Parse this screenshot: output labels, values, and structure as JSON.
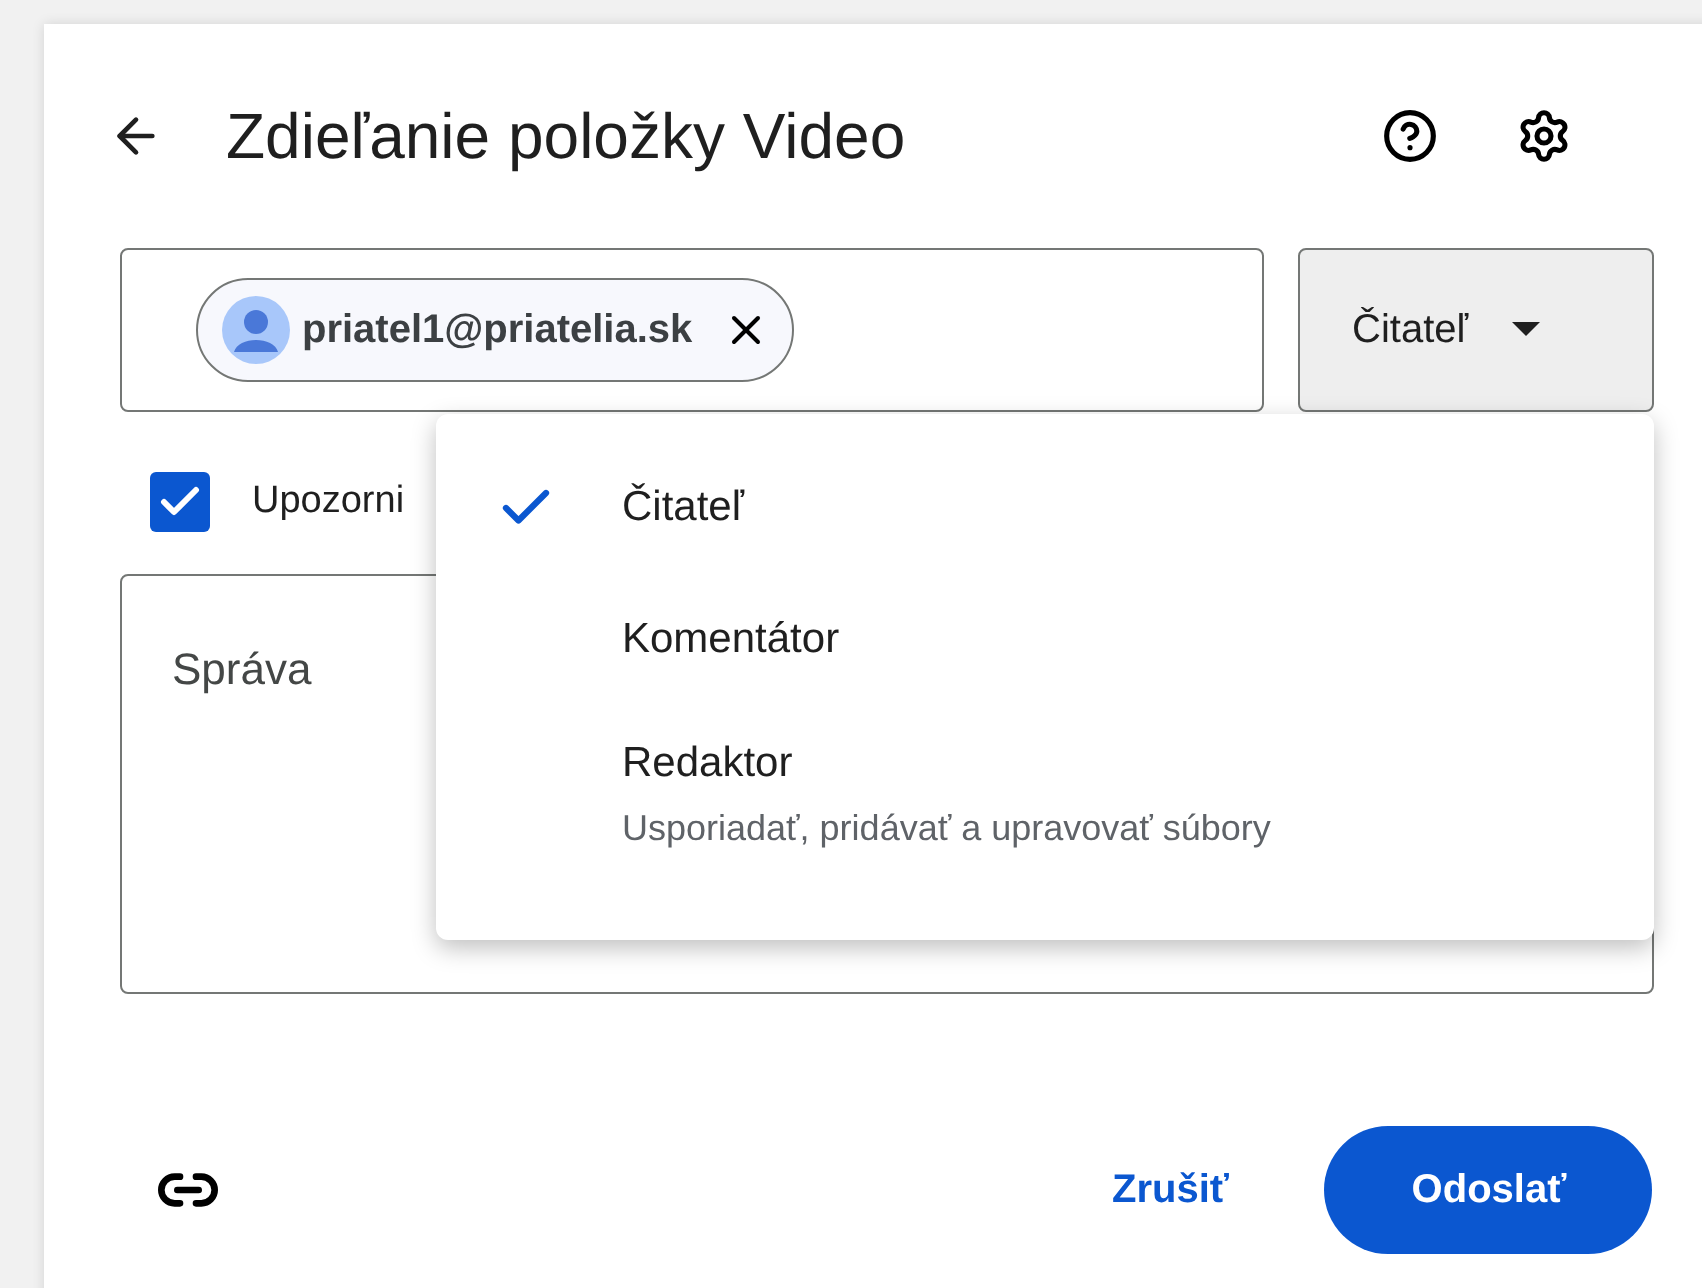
{
  "dialog": {
    "title": "Zdieľanie položky Video"
  },
  "recipient": {
    "email": "priatel1@priatelia.sk"
  },
  "role_button": {
    "label": "Čitateľ"
  },
  "notify": {
    "label": "Upozorni",
    "checked": true
  },
  "message": {
    "placeholder": "Správa"
  },
  "role_menu": [
    {
      "label": "Čitateľ",
      "selected": true
    },
    {
      "label": "Komentátor",
      "selected": false
    },
    {
      "label": "Redaktor",
      "description": "Usporiadať, pridávať a upravovať súbory",
      "selected": false
    }
  ],
  "footer": {
    "cancel": "Zrušiť",
    "send": "Odoslať"
  }
}
